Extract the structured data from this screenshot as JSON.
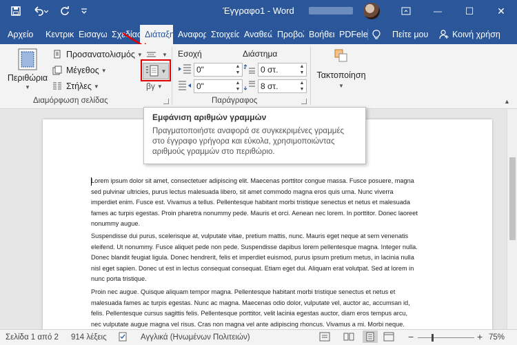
{
  "titlebar": {
    "doc_title": "Έγγραφο1 - Word",
    "save_icon": "save-icon",
    "undo_icon": "undo-icon",
    "redo_icon": "redo-icon",
    "minimize": "—",
    "restore": "☐",
    "close": "✕",
    "ribbon_options": "⧉"
  },
  "tabs": [
    {
      "label": "Αρχείο"
    },
    {
      "label": "Κεντρική"
    },
    {
      "label": "Εισαγωγή"
    },
    {
      "label": "Σχεδίαση"
    },
    {
      "label": "Διάταξη"
    },
    {
      "label": "Αναφορές"
    },
    {
      "label": "Στοιχεία"
    },
    {
      "label": "Αναθεώρηση"
    },
    {
      "label": "Προβολή"
    },
    {
      "label": "Βοήθεια"
    },
    {
      "label": "PDFelement"
    },
    {
      "label": "Πείτε μου"
    },
    {
      "label": "Κοινή χρήση"
    }
  ],
  "ribbon": {
    "margins_label": "Περιθώρια",
    "orientation_label": "Προσανατολισμός",
    "size_label": "Μέγεθος",
    "columns_label": "Στήλες",
    "hyphenation_label": "βγ",
    "page_setup_group": "Διαμόρφωση σελίδας",
    "indent_label": "Εσοχή",
    "spacing_label": "Διάστημα",
    "indent_left": "0\"",
    "indent_right": "0\"",
    "spacing_before": "0 στ.",
    "spacing_after": "8 στ.",
    "paragraph_group": "Παράγραφος",
    "arrange_label": "Τακτοποίηση"
  },
  "tooltip": {
    "title": "Εμφάνιση αριθμών γραμμών",
    "body": "Πραγματοποιήστε αναφορά σε συγκεκριμένες γραμμές στο έγγραφο γρήγορα και εύκολα, χρησιμοποιώντας αριθμούς γραμμών στο περιθώριο."
  },
  "document": {
    "paragraphs": [
      "Lorem ipsum dolor sit amet, consectetuer adipiscing elit. Maecenas porttitor congue massa. Fusce posuere, magna sed pulvinar ultricies, purus lectus malesuada libero, sit amet commodo magna eros quis urna. Nunc viverra imperdiet enim. Fusce est. Vivamus a tellus. Pellentesque habitant morbi tristique senectus et netus et malesuada fames ac turpis egestas. Proin pharetra nonummy pede. Mauris et orci. Aenean nec lorem. In porttitor. Donec laoreet nonummy augue.",
      "Suspendisse dui purus, scelerisque at, vulputate vitae, pretium mattis, nunc. Mauris eget neque at sem venenatis eleifend. Ut nonummy. Fusce aliquet pede non pede. Suspendisse dapibus lorem pellentesque magna. Integer nulla. Donec blandit feugiat ligula. Donec hendrerit, felis et imperdiet euismod, purus ipsum pretium metus, in lacinia nulla nisl eget sapien. Donec ut est in lectus consequat consequat. Etiam eget dui. Aliquam erat volutpat. Sed at lorem in nunc porta tristique.",
      "Proin nec augue. Quisque aliquam tempor magna. Pellentesque habitant morbi tristique senectus et netus et malesuada fames ac turpis egestas. Nunc ac magna. Maecenas odio dolor, vulputate vel, auctor ac, accumsan id, felis. Pellentesque cursus sagittis felis. Pellentesque porttitor, velit lacinia egestas auctor, diam eros tempus arcu, nec vulputate augue magna vel risus. Cras non magna vel ante adipiscing rhoncus. Vivamus a mi. Morbi neque. Aliquam erat volutpat. Integer ultrices lobortis eros."
    ]
  },
  "statusbar": {
    "page": "Σελίδα 1 από 2",
    "words": "914 λέξεις",
    "language": "Αγγλικά (Ηνωμένων Πολιτειών)",
    "zoom": "75%",
    "zoom_minus": "−",
    "zoom_plus": "+"
  },
  "colors": {
    "brand": "#2b579a",
    "highlight": "#e00000"
  }
}
